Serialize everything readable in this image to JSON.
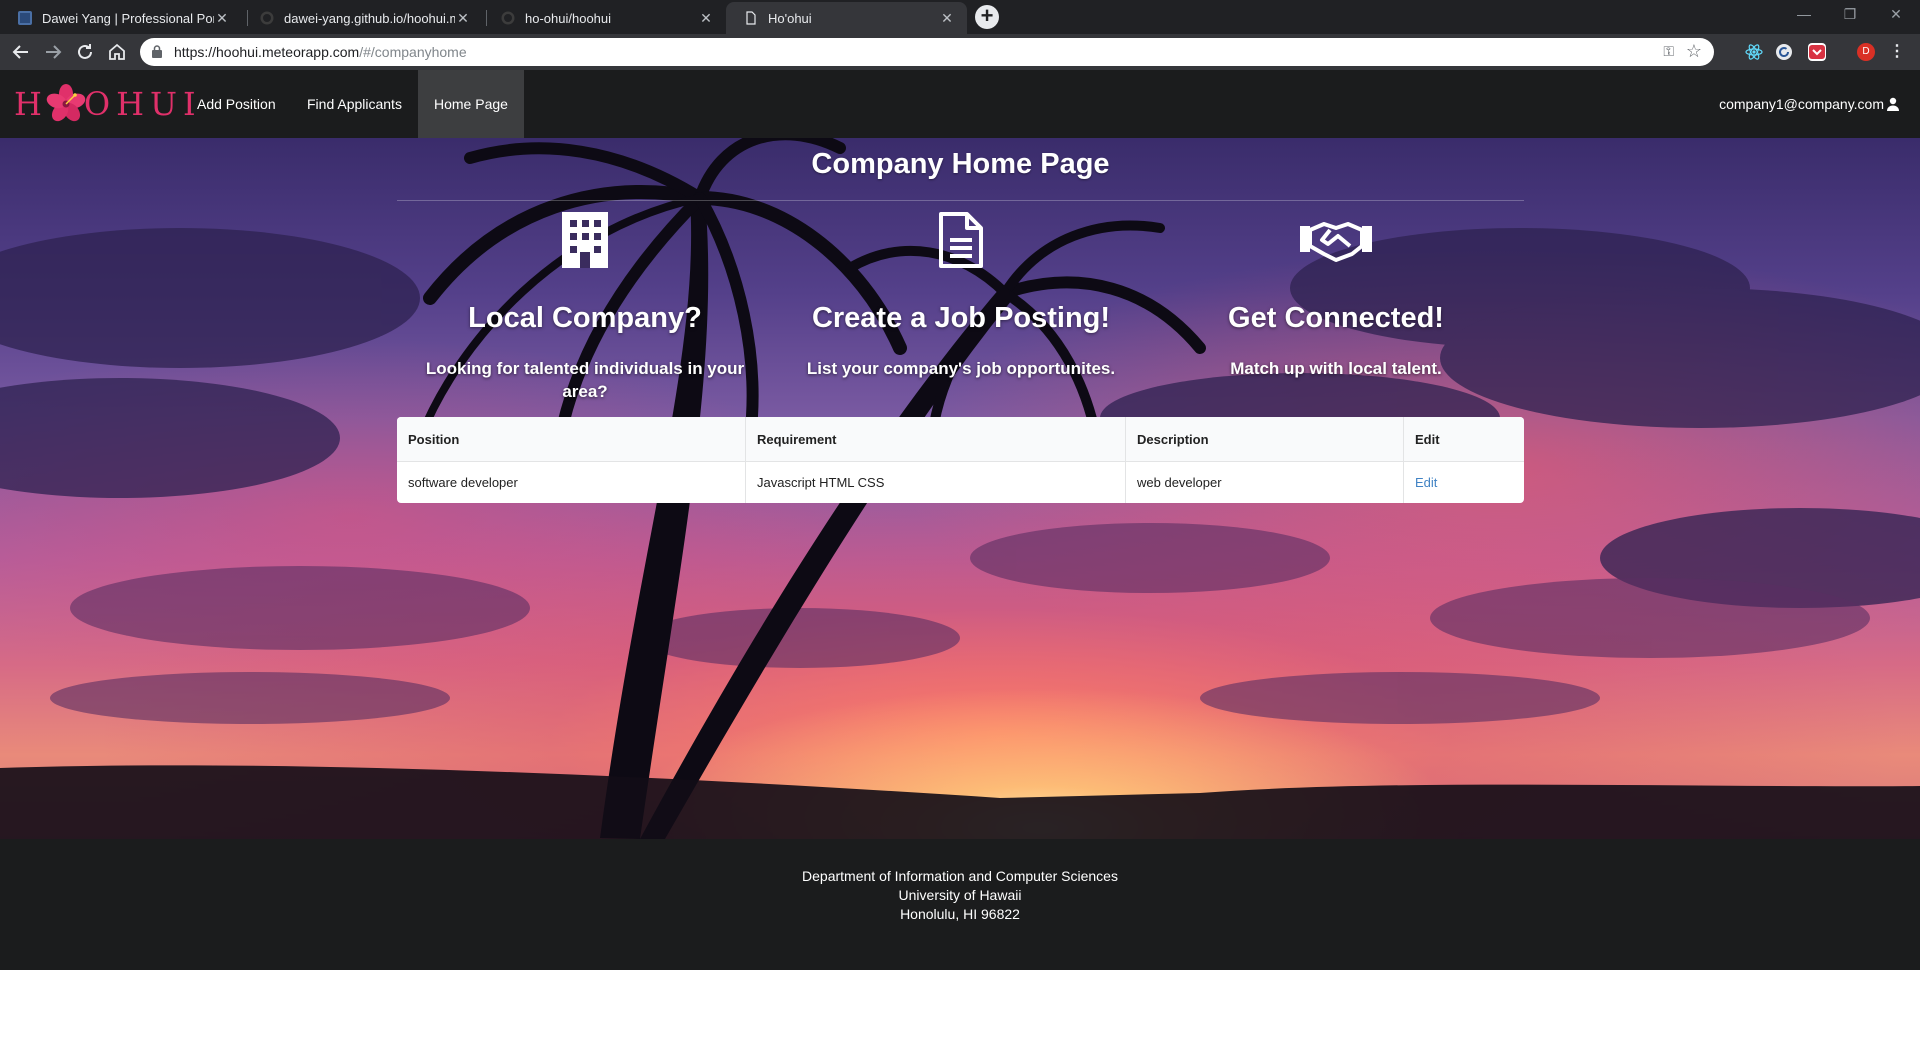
{
  "browser": {
    "tabs": [
      {
        "title": "Dawei Yang | Professional Portfol",
        "active": false
      },
      {
        "title": "dawei-yang.github.io/hoohui.md",
        "active": false
      },
      {
        "title": "ho-ohui/hoohui",
        "active": false
      },
      {
        "title": "Ho'ohui",
        "active": true
      }
    ],
    "url_host": "https://hoohui.meteorapp.com",
    "url_path": "/#/companyhome",
    "profile_initial": "D"
  },
  "navbar": {
    "logo_left": "H",
    "logo_right": "OHUI",
    "items": [
      "Add Position",
      "Find Applicants",
      "Home Page"
    ],
    "active_item": "Home Page",
    "user_email": "company1@company.com"
  },
  "hero": {
    "title": "Company Home Page",
    "features": [
      {
        "icon": "building-icon",
        "heading": "Local Company?",
        "text": "Looking for talented individuals in your area?"
      },
      {
        "icon": "file-icon",
        "heading": "Create a Job Posting!",
        "text": "List your company's job opportunites."
      },
      {
        "icon": "handshake-icon",
        "heading": "Get Connected!",
        "text": "Match up with local talent."
      }
    ]
  },
  "table": {
    "headers": [
      "Position",
      "Requirement",
      "Description",
      "Edit"
    ],
    "rows": [
      {
        "position": "software developer",
        "requirement": "Javascript HTML CSS",
        "description": "web developer",
        "edit": "Edit"
      }
    ]
  },
  "footer": {
    "line1": "Department of Information and Computer Sciences",
    "line2": "University of Hawaii",
    "line3": "Honolulu, HI 96822"
  },
  "colors": {
    "navbar_bg": "#1b1c1d",
    "logo_pink": "#e0306a",
    "link_blue": "#4183c4"
  }
}
